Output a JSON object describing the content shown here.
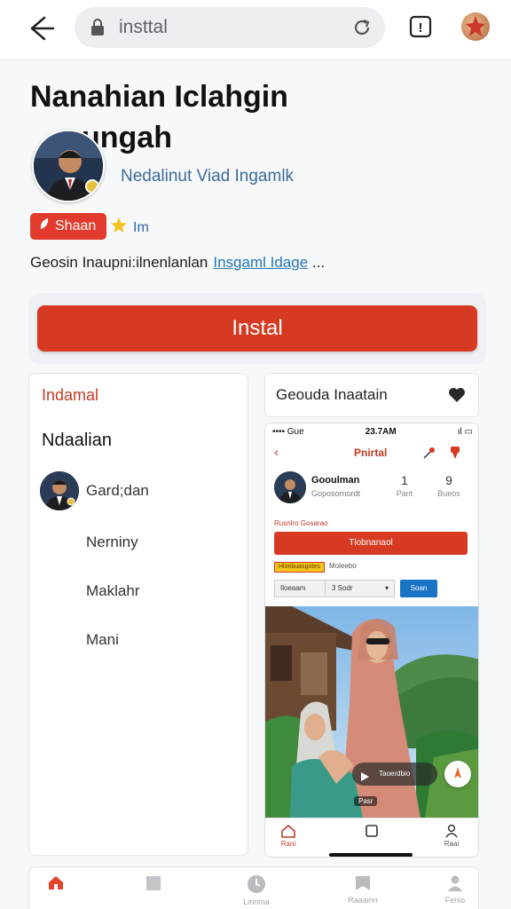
{
  "browser": {
    "url": "insttal",
    "tab_count": "!"
  },
  "app": {
    "title_line1": "Nanahian Iclahgin",
    "title_line2": "ungah",
    "developer": "Nedalinut Viad Ingamlk",
    "badge_label": "Shaan",
    "rating_label": "Im",
    "description": "Geosin Inaupni:ilnenlanlan",
    "description_link": "Insgaml Idage",
    "description_tail": "...",
    "install_label": "Instal"
  },
  "left_panel": {
    "header": "Indamal",
    "section_title": "Ndaalian",
    "items": [
      "Gard;dan",
      "Nerniny",
      "Maklahr",
      "Mani"
    ]
  },
  "right_panel": {
    "header": "Geouda Inaatain"
  },
  "phone": {
    "status_left": "•••• Gue",
    "status_time": "23.7AM",
    "status_right": "ıl ▭",
    "header_title": "Pnirtal",
    "profile_name": "Gooulman",
    "profile_sub": "Goposornordt",
    "stats": [
      {
        "value": "1",
        "label": "Parit"
      },
      {
        "value": "9",
        "label": "Bueos"
      }
    ],
    "section_label": "Rusnlro Gosarao",
    "primary_button": "Tlobnanaol",
    "tag_label": "Hlonbuasgotes",
    "tag_text": "Moleebo",
    "select_left": "Iloeaam",
    "select_value": "3 Sodr",
    "go_button": "Soan",
    "pill_text": "Taoerdbio",
    "photo_caption": "Pasr",
    "nav": [
      "Rani",
      "",
      "Raai"
    ]
  },
  "bottom_nav": {
    "items": [
      "",
      "",
      "Linnma",
      "Raaainn",
      "Fenio"
    ]
  },
  "colors": {
    "accent_red": "#d73a23",
    "link_blue": "#2277b8",
    "background": "#f7f8fa"
  }
}
